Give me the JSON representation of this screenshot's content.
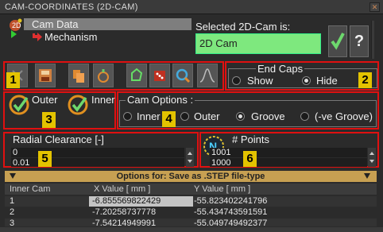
{
  "window": {
    "title": "CAM-COORDINATES (2D-CAM)"
  },
  "tree": {
    "items": [
      {
        "label": "Cam Data",
        "selected": true
      },
      {
        "label": "Mechanism",
        "selected": false
      }
    ]
  },
  "selected_cam": {
    "label": "Selected 2D-Cam is:",
    "value": "2D Cam"
  },
  "buttons": {
    "ok_icon": "check-icon",
    "help_label": "?"
  },
  "toolbar": {
    "tools": [
      "cancel-icon",
      "save-icon",
      "copy-icon",
      "cam-icon",
      "profile-icon",
      "dice-icon",
      "zoom-icon",
      "curve-icon"
    ]
  },
  "callouts": [
    "1",
    "2",
    "3",
    "4",
    "5",
    "6"
  ],
  "end_caps": {
    "title": "End Caps",
    "options": [
      "Show",
      "Hide"
    ],
    "selected": "Hide"
  },
  "outer_inner": {
    "outer": "Outer",
    "inner": "Inner",
    "outer_checked": true,
    "inner_checked": true
  },
  "cam_options": {
    "title": "Cam Options :",
    "options": [
      "Inner",
      "Outer",
      "Groove",
      "(-ve Groove)"
    ],
    "selected": "Groove"
  },
  "radial_clearance": {
    "label": "Radial Clearance [-]",
    "value1": "0",
    "value2": "0.01"
  },
  "points": {
    "label": "# Points",
    "value1": "1001",
    "value2": "1000",
    "icon": "N"
  },
  "options_bar": {
    "text": "Options for: Save as .STEP file-type"
  },
  "table": {
    "headers": [
      "Inner Cam",
      "X Value [ mm ]",
      "Y Value [ mm ]"
    ],
    "rows": [
      [
        "1",
        "-6.855569822429",
        "-55.823402241796"
      ],
      [
        "2",
        "-7.20258737778",
        "-55.434743591591"
      ],
      [
        "3",
        "-7.54214949991",
        "-55.049749492377"
      ]
    ]
  },
  "colors": {
    "callout_red": "#e01010",
    "badge_yellow": "#e3c300",
    "cam_box_green": "#7ee87e",
    "options_bar": "#c7a052"
  }
}
